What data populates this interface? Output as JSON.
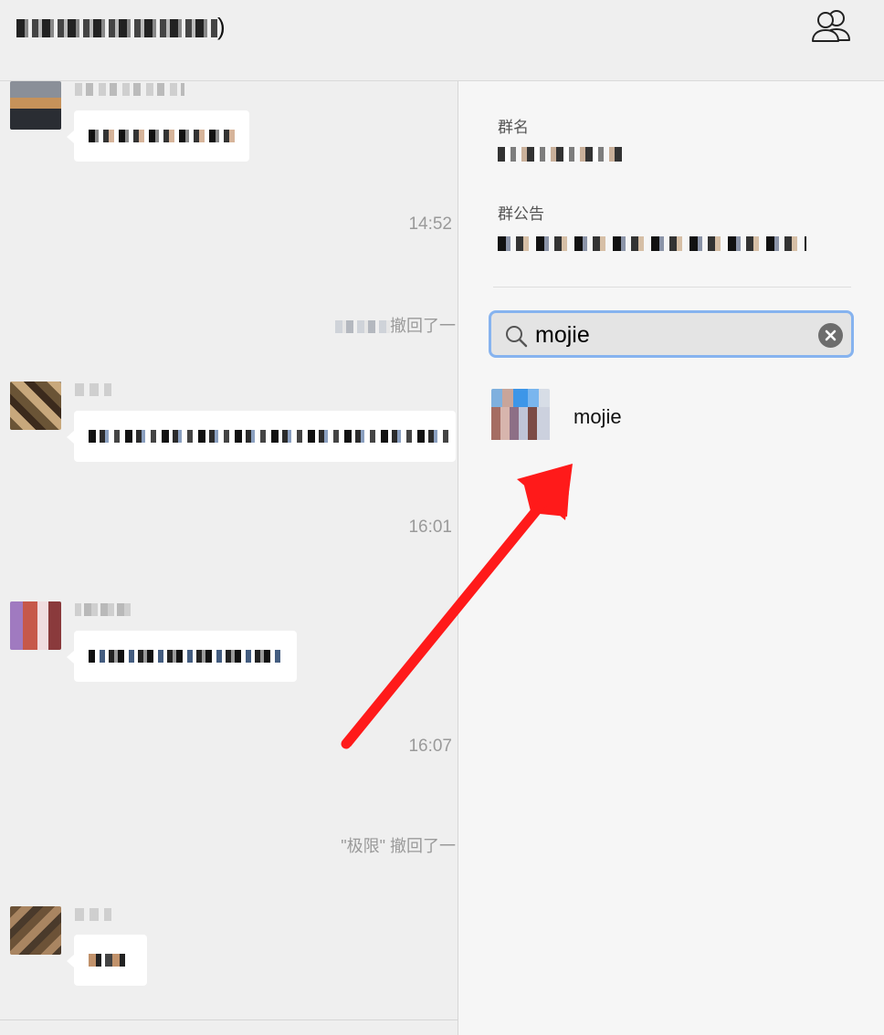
{
  "header": {
    "title_suffix": ")",
    "members_icon": "group-members-icon"
  },
  "chat": {
    "messages": [
      {
        "kind": "text",
        "avatar_colors": [
          "#3b3b3b",
          "#c98b4a",
          "#f1ede5",
          "#2a2d33"
        ]
      },
      {
        "kind": "timestamp",
        "time": "14:52"
      },
      {
        "kind": "recall",
        "suffix": "撤回了一"
      },
      {
        "kind": "text",
        "avatar_colors": [
          "#6a5436",
          "#c8a87c",
          "#3b2a1c",
          "#a88964"
        ]
      },
      {
        "kind": "timestamp",
        "time": "16:01"
      },
      {
        "kind": "text",
        "avatar_colors": [
          "#a07ac0",
          "#c6584a",
          "#f0dde0",
          "#8a3a3c"
        ]
      },
      {
        "kind": "timestamp",
        "time": "16:07"
      },
      {
        "kind": "recall",
        "name": "\"极限\"",
        "suffix": "撤回了一"
      },
      {
        "kind": "text",
        "avatar_colors": [
          "#6c5237",
          "#a98561",
          "#4a3a2b",
          "#8b7150"
        ]
      }
    ]
  },
  "panel": {
    "group_name_label": "群名",
    "announcement_label": "群公告",
    "search": {
      "value": "mojie",
      "placeholder": ""
    },
    "result": {
      "name": "mojie"
    }
  },
  "annotation": {
    "arrow_color": "#ff1a1a"
  }
}
